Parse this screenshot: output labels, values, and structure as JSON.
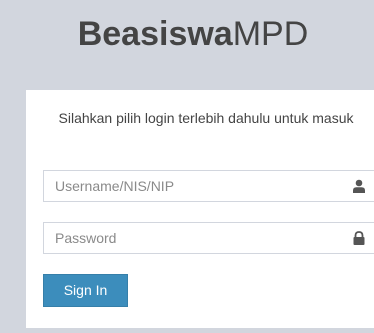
{
  "logo": {
    "bold": "Beasiswa",
    "light": "MPD"
  },
  "login": {
    "message": "Silahkan pilih login terlebih dahulu untuk masuk",
    "username_placeholder": "Username/NIS/NIP",
    "username_icon": "user-icon",
    "password_placeholder": "Password",
    "password_icon": "lock-icon",
    "signin_label": "Sign In"
  },
  "colors": {
    "background": "#d2d6de",
    "box": "#ffffff",
    "button": "#3c8dbc",
    "text": "#444444",
    "icon": "#555555"
  }
}
